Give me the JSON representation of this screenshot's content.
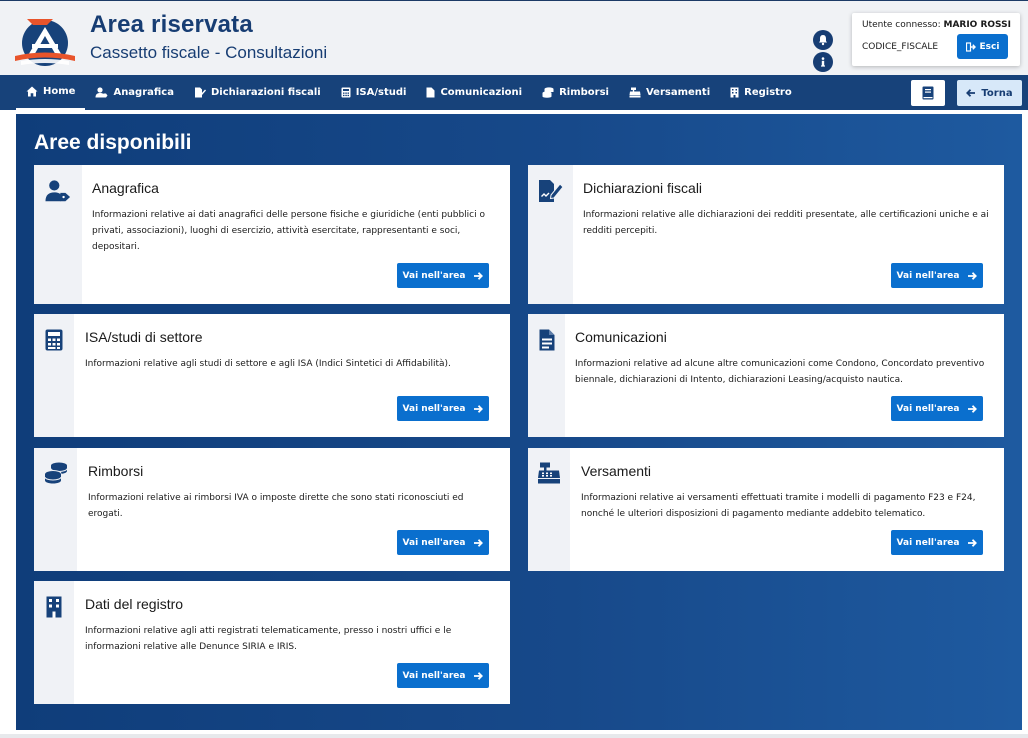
{
  "header": {
    "title": "Area riservata",
    "subtitle": "Cassetto fiscale - Consultazioni",
    "user_label": "Utente connesso:",
    "user_name": "MARIO ROSSI",
    "codice_fiscale": "CODICE_FISCALE",
    "logout_label": "Esci",
    "icons": [
      "bell-icon",
      "info-icon"
    ]
  },
  "nav": {
    "items": [
      {
        "label": "Home",
        "icon": "home-icon",
        "active": true
      },
      {
        "label": "Anagrafica",
        "icon": "user-tag-icon"
      },
      {
        "label": "Dichiarazioni fiscali",
        "icon": "file-signature-icon"
      },
      {
        "label": "ISA/studi",
        "icon": "calculator-icon"
      },
      {
        "label": "Comunicazioni",
        "icon": "file-icon"
      },
      {
        "label": "Rimborsi",
        "icon": "coins-icon"
      },
      {
        "label": "Versamenti",
        "icon": "cash-register-icon"
      },
      {
        "label": "Registro",
        "icon": "building-icon"
      }
    ],
    "back_label": "Torna",
    "book_icon": "book-icon"
  },
  "main": {
    "title": "Aree disponibili",
    "button_label": "Vai nell'area",
    "cards": [
      {
        "title": "Anagrafica",
        "icon": "user-tag-icon",
        "description": "Informazioni relative ai dati anagrafici delle persone fisiche e giuridiche (enti pubblici o privati, associazioni), luoghi di esercizio, attività esercitate, rappresentanti e soci, depositari."
      },
      {
        "title": "Dichiarazioni fiscali",
        "icon": "file-signature-icon",
        "description": "Informazioni relative alle dichiarazioni dei redditi presentate, alle certificazioni uniche e ai redditi percepiti."
      },
      {
        "title": "ISA/studi di settore",
        "icon": "calculator-icon",
        "description": "Informazioni relative agli studi di settore e agli ISA (Indici Sintetici di Affidabilità)."
      },
      {
        "title": "Comunicazioni",
        "icon": "file-alt-icon",
        "description": "Informazioni relative ad alcune altre comunicazioni come Condono, Concordato preventivo biennale, dichiarazioni di Intento, dichiarazioni Leasing/acquisto nautica."
      },
      {
        "title": "Rimborsi",
        "icon": "coins-icon",
        "description": "Informazioni relative ai rimborsi IVA o imposte dirette che sono stati riconosciuti ed erogati."
      },
      {
        "title": "Versamenti",
        "icon": "cash-register-icon",
        "description": "Informazioni relative ai versamenti effettuati tramite i modelli di pagamento F23 e F24, nonché le ulteriori disposizioni di pagamento mediante addebito telematico."
      },
      {
        "title": "Dati del registro",
        "icon": "building-icon",
        "description": "Informazioni relative agli atti registrati telematicamente, presso i nostri uffici e le informazioni relative alle Denunce SIRIA e IRIS."
      }
    ]
  },
  "colors": {
    "brand_navy": "#173d73",
    "nav_bg": "#17427a",
    "button_blue": "#0a6fce",
    "header_bg": "#f0f2f5"
  }
}
